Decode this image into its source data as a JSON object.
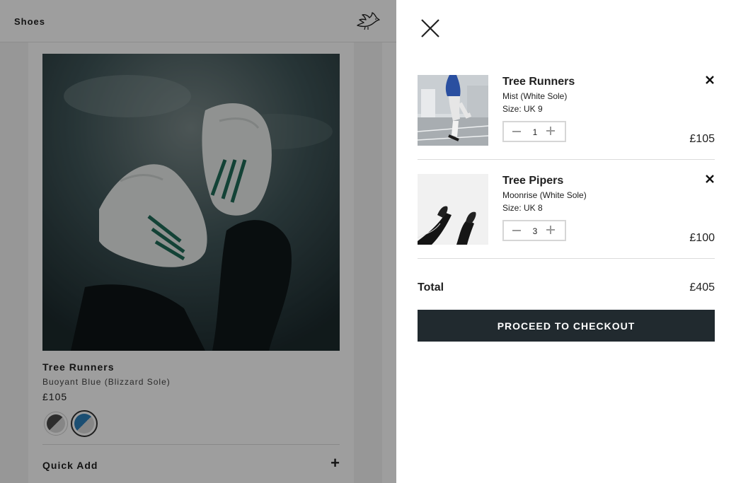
{
  "background_page": {
    "nav_label": "Shoes",
    "product": {
      "name": "Tree Runners",
      "color": "Buoyant Blue (Blizzard Sole)",
      "price": "£105",
      "quick_add_label": "Quick Add"
    },
    "swatches": [
      {
        "name": "grey",
        "colors": [
          "#4a4a4a",
          "#d8d8d8"
        ]
      },
      {
        "name": "blue",
        "colors": [
          "#2d7fb8",
          "#d8d8d8"
        ],
        "selected": true
      }
    ]
  },
  "cart": {
    "items": [
      {
        "name": "Tree Runners",
        "variant": "Mist (White Sole)",
        "size": "Size: UK 9",
        "quantity": "1",
        "price": "£105"
      },
      {
        "name": "Tree Pipers",
        "variant": "Moonrise (White Sole)",
        "size": "Size: UK 8",
        "quantity": "3",
        "price": "£100"
      }
    ],
    "total_label": "Total",
    "total_value": "£405",
    "checkout_label": "PROCEED TO CHECKOUT"
  },
  "colors": {
    "checkout_button": "#212a2f",
    "overlay": "rgba(0,0,0,0.38)",
    "text": "#212121"
  },
  "icons": {
    "close": "close-icon",
    "remove": "remove-icon",
    "minus": "minus-icon",
    "plus": "plus-icon",
    "logo": "bird-logo-icon"
  }
}
